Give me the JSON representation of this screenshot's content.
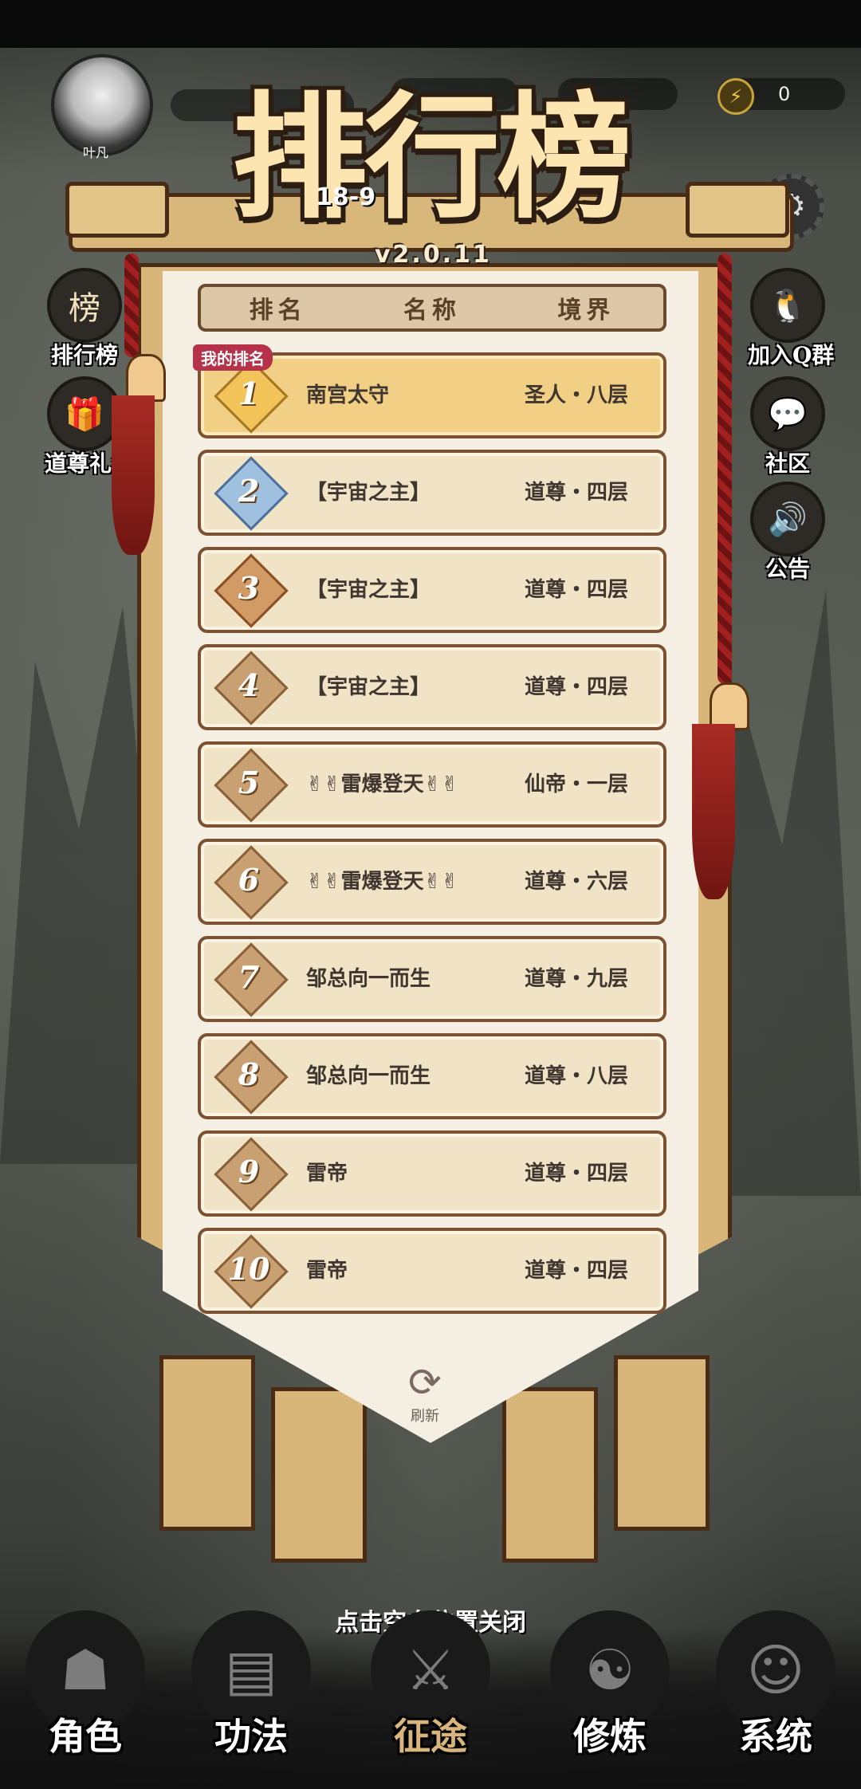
{
  "hud": {
    "player_name": "叶凡",
    "energy_value": "0",
    "level_text": "18-9"
  },
  "title": "排行榜",
  "version": "v2.0.11",
  "side_left": [
    {
      "label": "排行榜",
      "icon": "ranking-scroll-icon"
    },
    {
      "label": "道尊礼包",
      "icon": "gift-box-icon"
    }
  ],
  "side_right": [
    {
      "label": "加入Q群",
      "icon": "qq-penguin-icon"
    },
    {
      "label": "社区",
      "icon": "chat-bubble-icon"
    },
    {
      "label": "公告",
      "icon": "speaker-icon"
    }
  ],
  "table": {
    "headers": [
      "排名",
      "名称",
      "境界"
    ],
    "my_rank_tag": "我的排名",
    "rows": [
      {
        "rank": "1",
        "name": "南宫太守",
        "realm": "圣人・八层"
      },
      {
        "rank": "2",
        "name": "【宇宙之主】",
        "realm": "道尊・四层"
      },
      {
        "rank": "3",
        "name": "【宇宙之主】",
        "realm": "道尊・四层"
      },
      {
        "rank": "4",
        "name": "【宇宙之主】",
        "realm": "道尊・四层"
      },
      {
        "rank": "5",
        "name": "✌✌雷爆登天✌✌",
        "realm": "仙帝・一层"
      },
      {
        "rank": "6",
        "name": "✌✌雷爆登天✌✌",
        "realm": "道尊・六层"
      },
      {
        "rank": "7",
        "name": "邹总向一而生",
        "realm": "道尊・九层"
      },
      {
        "rank": "8",
        "name": "邹总向一而生",
        "realm": "道尊・八层"
      },
      {
        "rank": "9",
        "name": "雷帝",
        "realm": "道尊・四层"
      },
      {
        "rank": "10",
        "name": "雷帝",
        "realm": "道尊・四层"
      }
    ]
  },
  "refresh_label": "刷新",
  "close_hint": "点击空白位置关闭",
  "bottom_nav": [
    {
      "label": "角色",
      "icon": "hooded-character-icon",
      "active": false
    },
    {
      "label": "功法",
      "icon": "book-icon",
      "active": false
    },
    {
      "label": "征途",
      "icon": "sword-icon",
      "active": true
    },
    {
      "label": "修炼",
      "icon": "meditation-icon",
      "active": false
    },
    {
      "label": "系统",
      "icon": "mascot-icon",
      "active": false
    }
  ]
}
